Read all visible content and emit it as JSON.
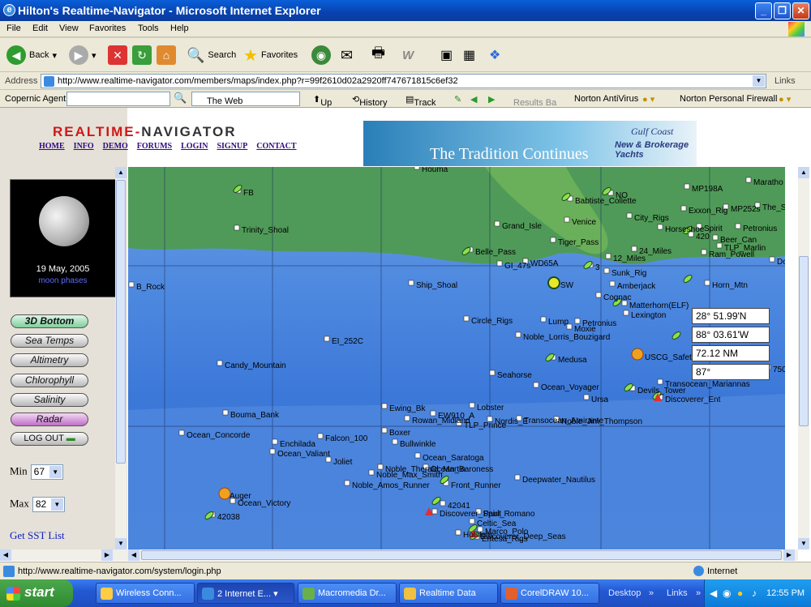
{
  "window": {
    "title": "Hilton's Realtime-Navigator - Microsoft Internet Explorer"
  },
  "menu": [
    "File",
    "Edit",
    "View",
    "Favorites",
    "Tools",
    "Help"
  ],
  "toolbar": {
    "back": "Back",
    "search": "Search",
    "favorites": "Favorites"
  },
  "address": {
    "label": "Address",
    "url": "http://www.realtime-navigator.com/members/maps/index.php?r=99f2610d02a2920ff747671815c6ef32",
    "links": "Links"
  },
  "agent": {
    "copernic": "Copernic Agent",
    "web": "The Web",
    "up": "Up",
    "history": "History",
    "track": "Track",
    "results": "Results Ba",
    "norton_av": "Norton AntiVirus",
    "norton_fw": "Norton Personal Firewall"
  },
  "site": {
    "logo_a": "REALTIME-",
    "logo_b": "NAVIGATOR",
    "nav": [
      "HOME",
      "INFO",
      "DEMO",
      "FORUMS",
      "LOGIN",
      "SIGNUP",
      "CONTACT"
    ],
    "moon_date": "19 May, 2005",
    "moon_link": "moon phases",
    "layers": [
      "3D Bottom",
      "Sea Temps",
      "Altimetry",
      "Chlorophyll",
      "Salinity",
      "Radar"
    ],
    "logout": "LOG OUT",
    "min_label": "Min",
    "min_value": "67",
    "max_label": "Max",
    "max_value": "82",
    "sst_link": "Get SST List",
    "banner_tagline": "The Tradition Continues",
    "banner_gulf": "Gulf Coast",
    "banner_brand": "New & Brokerage Yachts"
  },
  "map": {
    "readout": {
      "lat": "28° 51.99'N",
      "lon": "88° 03.61'W",
      "dist": "72.12 NM",
      "bearing": "87°"
    },
    "labels": [
      {
        "t": "Houma"
      },
      {
        "t": "FB"
      },
      {
        "t": "Trinity_Shoal"
      },
      {
        "t": "B_Rock"
      },
      {
        "t": "Ship_Shoal"
      },
      {
        "t": "Grand_Isle"
      },
      {
        "t": "Venice"
      },
      {
        "t": "Babtiste_Collette"
      },
      {
        "t": "NO"
      },
      {
        "t": "MP198A"
      },
      {
        "t": "Exxon_Rig"
      },
      {
        "t": "MP252s"
      },
      {
        "t": "The_Step"
      },
      {
        "t": "Maratho"
      },
      {
        "t": "City_Rigs"
      },
      {
        "t": "Horseshoe"
      },
      {
        "t": "Spirit"
      },
      {
        "t": "Petronius"
      },
      {
        "t": "Beer_Can"
      },
      {
        "t": "420"
      },
      {
        "t": "TLP_Marlin"
      },
      {
        "t": "Ram_Powell"
      },
      {
        "t": "Doubl"
      },
      {
        "t": "Tiger_Pass"
      },
      {
        "t": "24_Miles"
      },
      {
        "t": "12_Miles"
      },
      {
        "t": "Belle_Pass"
      },
      {
        "t": "GI_47s"
      },
      {
        "t": "WD65A"
      },
      {
        "t": "3"
      },
      {
        "t": "Sunk_Rig"
      },
      {
        "t": "SW"
      },
      {
        "t": "Amberjack"
      },
      {
        "t": "Horn_Mtn"
      },
      {
        "t": "Cognac"
      },
      {
        "t": "Matterhorn(ELF)"
      },
      {
        "t": "Lexington"
      },
      {
        "t": "Petronius"
      },
      {
        "t": "Circle_Rigs"
      },
      {
        "t": "Lump"
      },
      {
        "t": "Moxie"
      },
      {
        "t": "Noble_Lorris_Bouzigard"
      },
      {
        "t": "EI_252C"
      },
      {
        "t": "Candy_Mountain"
      },
      {
        "t": "Medusa"
      },
      {
        "t": "USCG_Safety"
      },
      {
        "t": "Seahorse"
      },
      {
        "t": "Ocean_Voyager"
      },
      {
        "t": "Ursa"
      },
      {
        "t": "Devils_Tower"
      },
      {
        "t": "Transocean_Mariannas"
      },
      {
        "t": "Discoverer_Ent"
      },
      {
        "t": "Bouma_Bank"
      },
      {
        "t": "Ewing_Bk"
      },
      {
        "t": "EW910_A"
      },
      {
        "t": "Lobster"
      },
      {
        "t": "Rowan_Midland"
      },
      {
        "t": "TLP_Prince"
      },
      {
        "t": "Nordis_E"
      },
      {
        "t": "Transocean_Amirante"
      },
      {
        "t": "Noble_Jim_Thompson"
      },
      {
        "t": "Ocean_Concorde"
      },
      {
        "t": "Boxer"
      },
      {
        "t": "Enchilada"
      },
      {
        "t": "Falcon_100"
      },
      {
        "t": "Bullwinkle"
      },
      {
        "t": "Ocean_Valiant"
      },
      {
        "t": "Joliet"
      },
      {
        "t": "Ocean_Saratoga"
      },
      {
        "t": "Noble_Therald_Martin"
      },
      {
        "t": "Noble_Max_Smith"
      },
      {
        "t": "Ocean_Baroness"
      },
      {
        "t": "Front_Runner"
      },
      {
        "t": "Noble_Amos_Runner"
      },
      {
        "t": "Deepwater_Nautilus"
      },
      {
        "t": "Auger"
      },
      {
        "t": "Ocean_Victory"
      },
      {
        "t": "42041"
      },
      {
        "t": "42038"
      },
      {
        "t": "Discoverer_Spirit"
      },
      {
        "t": "Paul_Romano"
      },
      {
        "t": "Celtic_Sea"
      },
      {
        "t": "Marco_Polo"
      },
      {
        "t": "Holstein"
      },
      {
        "t": "Discoverer_Deep_Seas"
      },
      {
        "t": "Entesa_Rigs"
      },
      {
        "t": "750"
      }
    ]
  },
  "status": {
    "url": "http://www.realtime-navigator.com/system/login.php",
    "zone": "Internet"
  },
  "taskbar": {
    "start": "start",
    "tasks": [
      "Wireless Conn...",
      "2 Internet E...",
      "Macromedia Dr...",
      "Realtime Data",
      "CorelDRAW 10..."
    ],
    "desktop": "Desktop",
    "links": "Links",
    "clock": "12:55 PM"
  }
}
